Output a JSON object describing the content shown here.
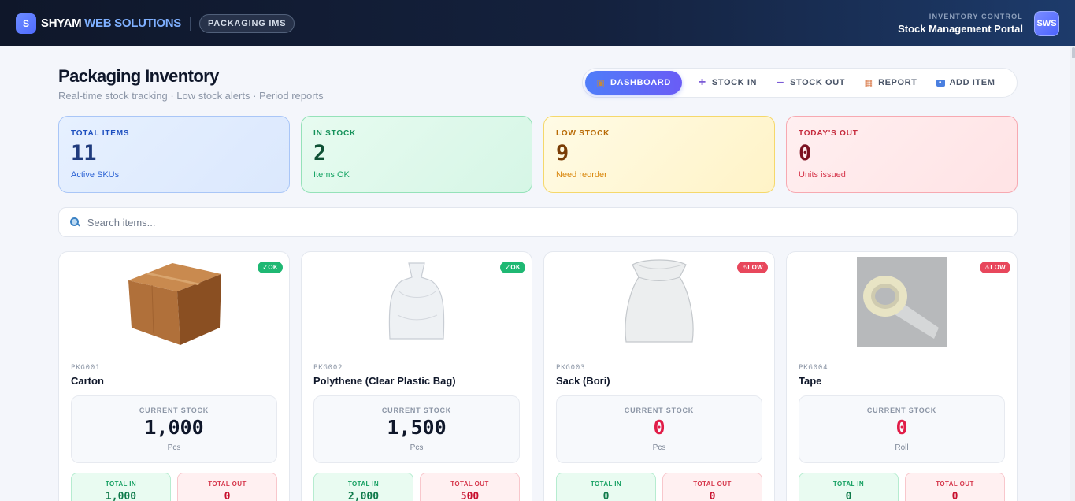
{
  "header": {
    "logo_letter": "S",
    "brand_main": "SHYAM",
    "brand_accent": "WEB SOLUTIONS",
    "module_pill": "PACKAGING IMS",
    "section_label": "INVENTORY CONTROL",
    "portal_title": "Stock Management Portal",
    "avatar_initials": "SWS"
  },
  "page": {
    "title": "Packaging Inventory",
    "subtitle": "Real-time stock tracking · Low stock alerts · Period reports"
  },
  "nav": {
    "items": [
      {
        "label": "DASHBOARD",
        "icon": "box-icon",
        "active": true
      },
      {
        "label": "STOCK IN",
        "icon": "plus-icon"
      },
      {
        "label": "STOCK OUT",
        "icon": "minus-icon"
      },
      {
        "label": "REPORT",
        "icon": "bar-chart-icon"
      },
      {
        "label": "ADD ITEM",
        "icon": "new-icon"
      }
    ]
  },
  "stats": [
    {
      "label": "TOTAL ITEMS",
      "value": "11",
      "sub": "Active SKUs",
      "color": "#1d4fbf"
    },
    {
      "label": "IN STOCK",
      "value": "2",
      "sub": "Items OK",
      "color": "#15915a"
    },
    {
      "label": "LOW STOCK",
      "value": "9",
      "sub": "Need reorder",
      "color": "#b86a05"
    },
    {
      "label": "TODAY'S OUT",
      "value": "0",
      "sub": "Units issued",
      "color": "#c62c3e"
    }
  ],
  "search": {
    "placeholder": "Search items..."
  },
  "items": [
    {
      "code": "PKG001",
      "name": "Carton",
      "badge": "✓OK",
      "status": "ok",
      "current_label": "CURRENT STOCK",
      "current": "1,000",
      "unit": "Pcs",
      "in_label": "TOTAL IN",
      "total_in": "1,000",
      "out_label": "TOTAL OUT",
      "total_out": "0"
    },
    {
      "code": "PKG002",
      "name": "Polythene (Clear Plastic Bag)",
      "badge": "✓OK",
      "status": "ok",
      "current_label": "CURRENT STOCK",
      "current": "1,500",
      "unit": "Pcs",
      "in_label": "TOTAL IN",
      "total_in": "2,000",
      "out_label": "TOTAL OUT",
      "total_out": "500"
    },
    {
      "code": "PKG003",
      "name": "Sack (Bori)",
      "badge": "⚠LOW",
      "status": "low",
      "current_label": "CURRENT STOCK",
      "current": "0",
      "unit": "Pcs",
      "in_label": "TOTAL IN",
      "total_in": "0",
      "out_label": "TOTAL OUT",
      "total_out": "0"
    },
    {
      "code": "PKG004",
      "name": "Tape",
      "badge": "⚠LOW",
      "status": "low",
      "current_label": "CURRENT STOCK",
      "current": "0",
      "unit": "Roll",
      "in_label": "TOTAL IN",
      "total_in": "0",
      "out_label": "TOTAL OUT",
      "total_out": "0"
    }
  ],
  "colors": {
    "accent": "#4f7df9",
    "ok": "#1fb873",
    "low": "#e8475c",
    "header_bg": "#0f172a"
  }
}
